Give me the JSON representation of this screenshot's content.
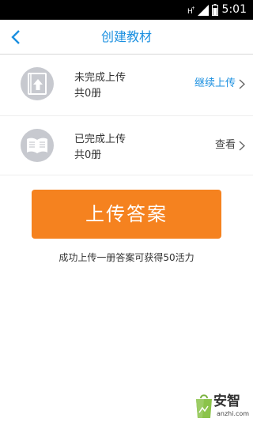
{
  "status_bar": {
    "time": "5:01",
    "icons": [
      "hplus-icon",
      "signal-icon",
      "battery-icon"
    ]
  },
  "header": {
    "back_icon": "chevron-left-icon",
    "title": "创建教材"
  },
  "rows": [
    {
      "icon": "upload-book-icon",
      "title": "未完成上传",
      "count": "共0册",
      "action": "继续上传",
      "action_color": "#1a8fe0"
    },
    {
      "icon": "open-book-icon",
      "title": "已完成上传",
      "count": "共0册",
      "action": "查看",
      "action_color": "#444444"
    }
  ],
  "upload_button": {
    "label": "上传答案",
    "color": "#f5821f"
  },
  "hint": "成功上传一册答案可获得50活力",
  "watermark": {
    "brand": "安智",
    "url": "anzhi.com"
  },
  "colors": {
    "accent": "#1a8fe0",
    "icon_bg": "#c7c9cf"
  }
}
